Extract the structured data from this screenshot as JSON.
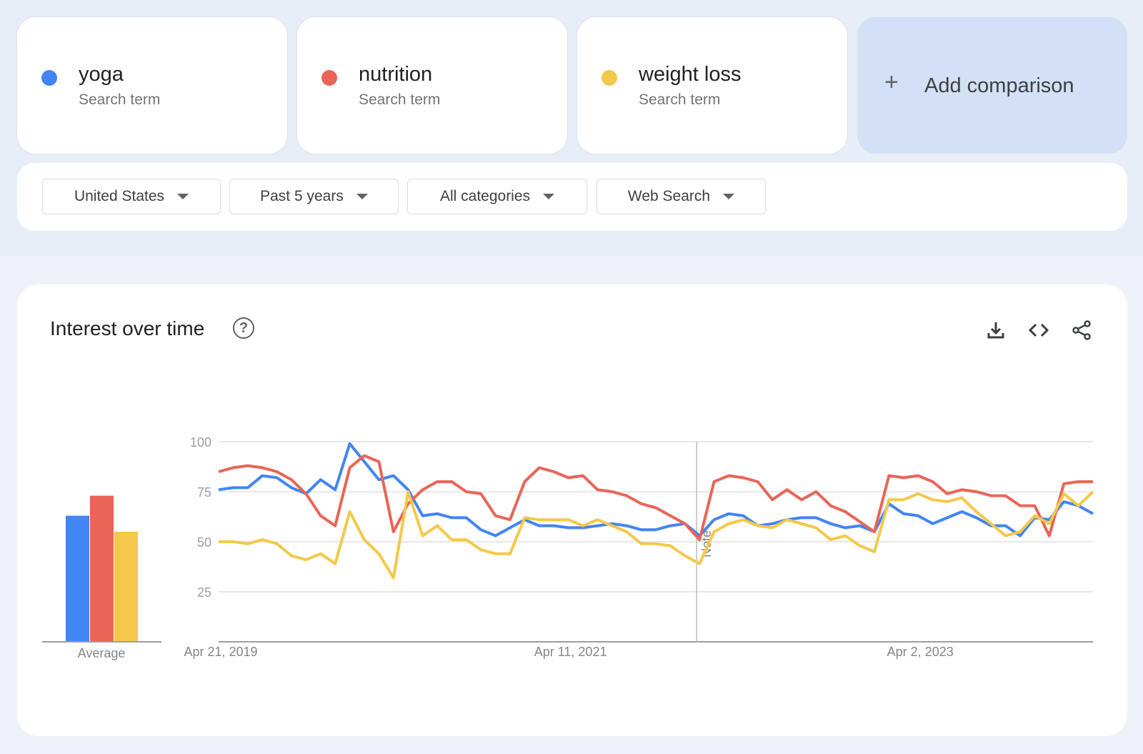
{
  "terms": [
    {
      "label": "yoga",
      "type": "Search term",
      "color": "#4285f4"
    },
    {
      "label": "nutrition",
      "type": "Search term",
      "color": "#ea6557"
    },
    {
      "label": "weight loss",
      "type": "Search term",
      "color": "#f4c84a"
    }
  ],
  "add_comparison": {
    "icon": "plus-icon",
    "label": "Add comparison"
  },
  "filters": [
    {
      "label": "United States"
    },
    {
      "label": "Past 5 years"
    },
    {
      "label": "All categories"
    },
    {
      "label": "Web Search"
    }
  ],
  "panel": {
    "title": "Interest over time",
    "icons": [
      "help-icon",
      "download-icon",
      "embed-code-icon",
      "share-icon"
    ]
  },
  "chart_data": {
    "type": "line",
    "title": "",
    "ylim": [
      0,
      100
    ],
    "yticks": [
      "100",
      "75",
      "50",
      "25"
    ],
    "ytick_values": [
      100,
      75,
      50,
      25
    ],
    "xtick_labels": [
      "Apr 21, 2019",
      "Apr 11, 2021",
      "Apr 2, 2023"
    ],
    "xtick_dates": [
      "2019-04",
      "2021-04",
      "2023-04"
    ],
    "grid": true,
    "annotation": {
      "label": "Note",
      "date": "2022-01"
    },
    "average": {
      "label": "Average",
      "values": [
        63,
        73,
        55
      ]
    },
    "x": [
      "2019-04",
      "2019-05",
      "2019-06",
      "2019-07",
      "2019-08",
      "2019-09",
      "2019-10",
      "2019-11",
      "2019-12",
      "2020-01",
      "2020-02",
      "2020-03",
      "2020-04",
      "2020-05",
      "2020-06",
      "2020-07",
      "2020-08",
      "2020-09",
      "2020-10",
      "2020-11",
      "2020-12",
      "2021-01",
      "2021-02",
      "2021-03",
      "2021-04",
      "2021-05",
      "2021-06",
      "2021-07",
      "2021-08",
      "2021-09",
      "2021-10",
      "2021-11",
      "2021-12",
      "2022-01",
      "2022-02",
      "2022-03",
      "2022-04",
      "2022-05",
      "2022-06",
      "2022-07",
      "2022-08",
      "2022-09",
      "2022-10",
      "2022-11",
      "2022-12",
      "2023-01",
      "2023-02",
      "2023-03",
      "2023-04",
      "2023-05",
      "2023-06",
      "2023-07",
      "2023-08",
      "2023-09",
      "2023-10",
      "2023-11",
      "2023-12",
      "2024-01",
      "2024-02",
      "2024-03",
      "2024-04"
    ],
    "series": [
      {
        "name": "yoga",
        "color": "#4285f4",
        "values": [
          76,
          77,
          77,
          83,
          82,
          77,
          74,
          81,
          76,
          99,
          90,
          81,
          83,
          76,
          63,
          64,
          62,
          62,
          56,
          53,
          57,
          61,
          58,
          58,
          57,
          57,
          58,
          59,
          58,
          56,
          56,
          58,
          59,
          53,
          61,
          64,
          63,
          58,
          59,
          61,
          62,
          62,
          59,
          57,
          58,
          55,
          69,
          64,
          63,
          59,
          62,
          65,
          62,
          58,
          58,
          53,
          62,
          61,
          70,
          68,
          64
        ]
      },
      {
        "name": "nutrition",
        "color": "#ea6557",
        "values": [
          85,
          87,
          88,
          87,
          85,
          81,
          74,
          63,
          58,
          87,
          93,
          90,
          55,
          69,
          76,
          80,
          80,
          75,
          74,
          63,
          61,
          80,
          87,
          85,
          82,
          83,
          76,
          75,
          73,
          69,
          67,
          63,
          59,
          51,
          80,
          83,
          82,
          80,
          71,
          76,
          71,
          75,
          68,
          65,
          60,
          55,
          83,
          82,
          83,
          80,
          74,
          76,
          75,
          73,
          73,
          68,
          68,
          53,
          79,
          80,
          80
        ]
      },
      {
        "name": "weight loss",
        "color": "#f4c84a",
        "values": [
          50,
          50,
          49,
          51,
          49,
          43,
          41,
          44,
          39,
          65,
          51,
          44,
          32,
          75,
          53,
          58,
          51,
          51,
          46,
          44,
          44,
          62,
          61,
          61,
          61,
          58,
          61,
          58,
          55,
          49,
          49,
          48,
          43,
          39,
          55,
          59,
          61,
          58,
          57,
          61,
          59,
          57,
          51,
          53,
          48,
          45,
          71,
          71,
          74,
          71,
          70,
          72,
          65,
          59,
          53,
          55,
          63,
          59,
          74,
          68,
          75
        ]
      }
    ]
  }
}
